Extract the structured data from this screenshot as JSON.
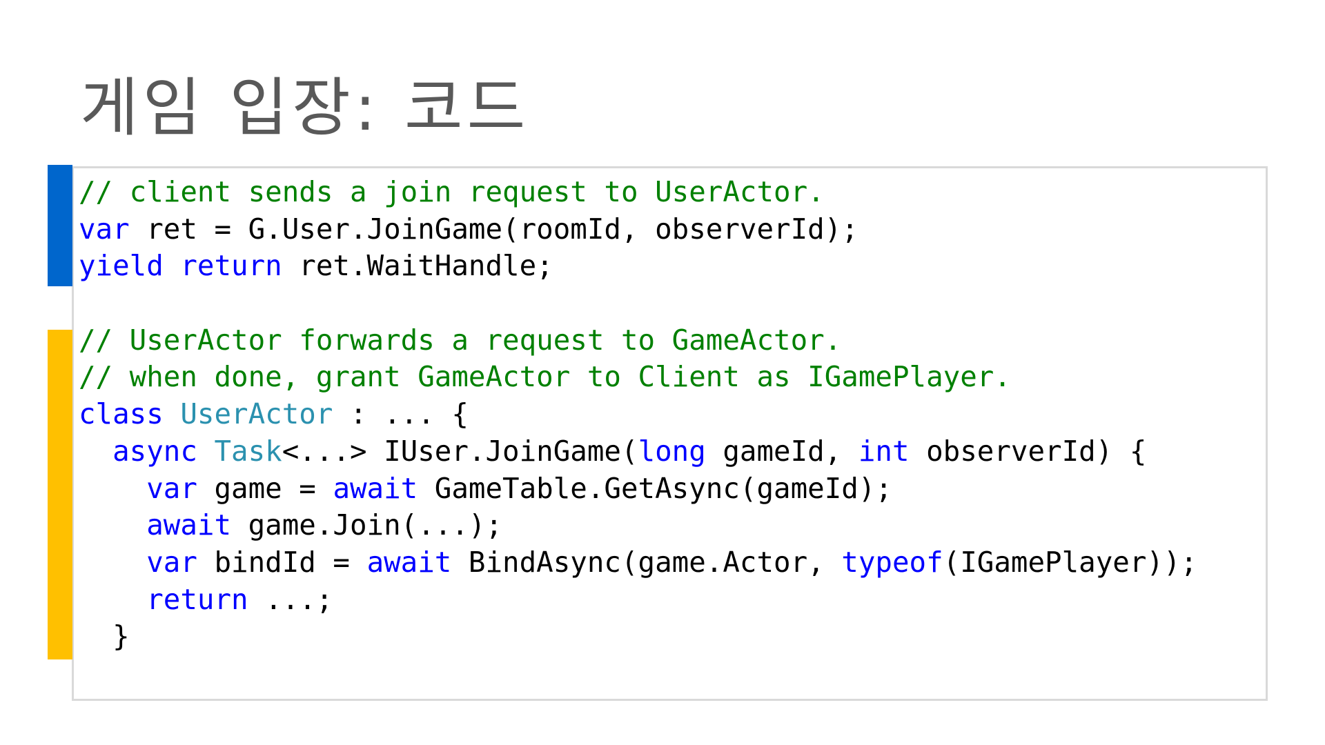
{
  "slide": {
    "title": "게임 입장: 코드"
  },
  "colors": {
    "accent_blue": "#0066cc",
    "accent_yellow": "#ffc000",
    "comment": "#008000",
    "keyword": "#0000ff",
    "type": "#2b91af",
    "text": "#000000",
    "title": "#595959",
    "panel_border": "#d9d9d9"
  },
  "code": {
    "lines": [
      [
        {
          "kind": "comment",
          "text": "// client sends a join request to UserActor."
        }
      ],
      [
        {
          "kind": "keyword",
          "text": "var"
        },
        {
          "kind": "plain",
          "text": " ret = G.User.JoinGame(roomId, observerId);"
        }
      ],
      [
        {
          "kind": "keyword",
          "text": "yield"
        },
        {
          "kind": "plain",
          "text": " "
        },
        {
          "kind": "keyword",
          "text": "return"
        },
        {
          "kind": "plain",
          "text": " ret.WaitHandle;"
        }
      ],
      [
        {
          "kind": "plain",
          "text": ""
        }
      ],
      [
        {
          "kind": "comment",
          "text": "// UserActor forwards a request to GameActor."
        }
      ],
      [
        {
          "kind": "comment",
          "text": "// when done, grant GameActor to Client as IGamePlayer."
        }
      ],
      [
        {
          "kind": "keyword",
          "text": "class"
        },
        {
          "kind": "plain",
          "text": " "
        },
        {
          "kind": "type",
          "text": "UserActor"
        },
        {
          "kind": "plain",
          "text": " : ... {"
        }
      ],
      [
        {
          "kind": "plain",
          "text": "  "
        },
        {
          "kind": "keyword",
          "text": "async"
        },
        {
          "kind": "plain",
          "text": " "
        },
        {
          "kind": "type",
          "text": "Task"
        },
        {
          "kind": "plain",
          "text": "<...> IUser.JoinGame("
        },
        {
          "kind": "keyword",
          "text": "long"
        },
        {
          "kind": "plain",
          "text": " gameId, "
        },
        {
          "kind": "keyword",
          "text": "int"
        },
        {
          "kind": "plain",
          "text": " observerId) {"
        }
      ],
      [
        {
          "kind": "plain",
          "text": "    "
        },
        {
          "kind": "keyword",
          "text": "var"
        },
        {
          "kind": "plain",
          "text": " game = "
        },
        {
          "kind": "keyword",
          "text": "await"
        },
        {
          "kind": "plain",
          "text": " GameTable.GetAsync(gameId);"
        }
      ],
      [
        {
          "kind": "plain",
          "text": "    "
        },
        {
          "kind": "keyword",
          "text": "await"
        },
        {
          "kind": "plain",
          "text": " game.Join(...);"
        }
      ],
      [
        {
          "kind": "plain",
          "text": "    "
        },
        {
          "kind": "keyword",
          "text": "var"
        },
        {
          "kind": "plain",
          "text": " bindId = "
        },
        {
          "kind": "keyword",
          "text": "await"
        },
        {
          "kind": "plain",
          "text": " BindAsync(game.Actor, "
        },
        {
          "kind": "keyword",
          "text": "typeof"
        },
        {
          "kind": "plain",
          "text": "(IGamePlayer));"
        }
      ],
      [
        {
          "kind": "plain",
          "text": "    "
        },
        {
          "kind": "keyword",
          "text": "return"
        },
        {
          "kind": "plain",
          "text": " ...;"
        }
      ],
      [
        {
          "kind": "plain",
          "text": "  }"
        }
      ]
    ]
  }
}
